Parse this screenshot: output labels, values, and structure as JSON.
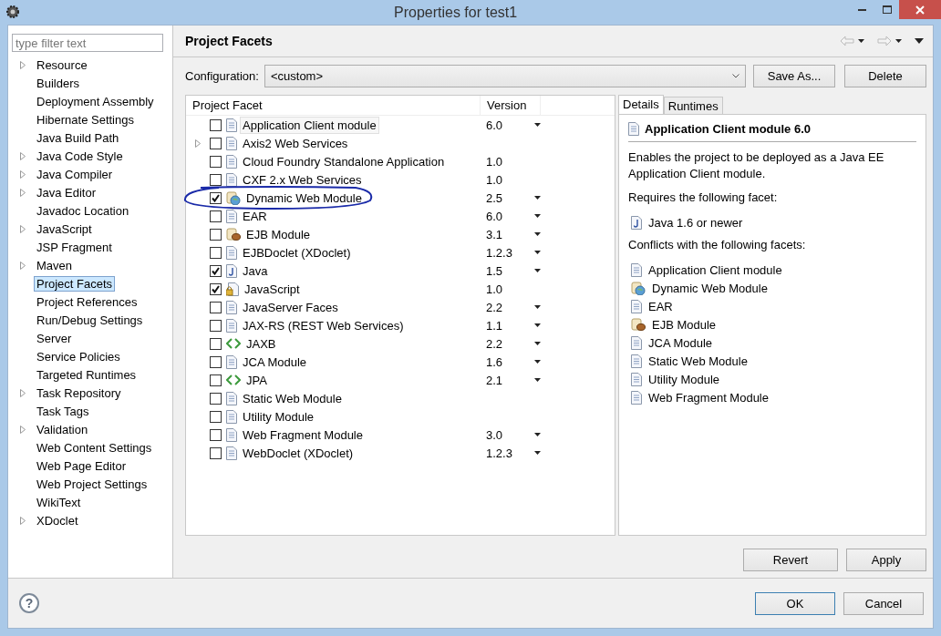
{
  "window": {
    "title": "Properties for test1"
  },
  "sidebar": {
    "filter_placeholder": "type filter text",
    "items": [
      {
        "label": "Resource",
        "expandable": true,
        "selected": false
      },
      {
        "label": "Builders",
        "expandable": false,
        "selected": false
      },
      {
        "label": "Deployment Assembly",
        "expandable": false,
        "selected": false
      },
      {
        "label": "Hibernate Settings",
        "expandable": false,
        "selected": false
      },
      {
        "label": "Java Build Path",
        "expandable": false,
        "selected": false
      },
      {
        "label": "Java Code Style",
        "expandable": true,
        "selected": false
      },
      {
        "label": "Java Compiler",
        "expandable": true,
        "selected": false
      },
      {
        "label": "Java Editor",
        "expandable": true,
        "selected": false
      },
      {
        "label": "Javadoc Location",
        "expandable": false,
        "selected": false
      },
      {
        "label": "JavaScript",
        "expandable": true,
        "selected": false
      },
      {
        "label": "JSP Fragment",
        "expandable": false,
        "selected": false
      },
      {
        "label": "Maven",
        "expandable": true,
        "selected": false
      },
      {
        "label": "Project Facets",
        "expandable": false,
        "selected": true
      },
      {
        "label": "Project References",
        "expandable": false,
        "selected": false
      },
      {
        "label": "Run/Debug Settings",
        "expandable": false,
        "selected": false
      },
      {
        "label": "Server",
        "expandable": false,
        "selected": false
      },
      {
        "label": "Service Policies",
        "expandable": false,
        "selected": false
      },
      {
        "label": "Targeted Runtimes",
        "expandable": false,
        "selected": false
      },
      {
        "label": "Task Repository",
        "expandable": true,
        "selected": false
      },
      {
        "label": "Task Tags",
        "expandable": false,
        "selected": false
      },
      {
        "label": "Validation",
        "expandable": true,
        "selected": false
      },
      {
        "label": "Web Content Settings",
        "expandable": false,
        "selected": false
      },
      {
        "label": "Web Page Editor",
        "expandable": false,
        "selected": false
      },
      {
        "label": "Web Project Settings",
        "expandable": false,
        "selected": false
      },
      {
        "label": "WikiText",
        "expandable": false,
        "selected": false
      },
      {
        "label": "XDoclet",
        "expandable": true,
        "selected": false
      }
    ]
  },
  "page": {
    "title": "Project Facets",
    "configuration": {
      "label": "Configuration:",
      "value": "<custom>"
    },
    "buttons": [
      "Save As...",
      "Delete"
    ]
  },
  "facets_table": {
    "columns": [
      "Project Facet",
      "Version"
    ],
    "rows": [
      {
        "name": "Application Client module",
        "kind": "document",
        "version": "6.0",
        "version_dropdown": true,
        "checked": false,
        "expandable": false,
        "selected": true,
        "circled": false
      },
      {
        "name": "Axis2 Web Services",
        "kind": "document",
        "checked": false,
        "expandable": true,
        "selected": false,
        "circled": false
      },
      {
        "name": "Cloud Foundry Standalone Application",
        "kind": "document",
        "version": "1.0",
        "version_dropdown": false,
        "checked": false,
        "expandable": false,
        "selected": false,
        "circled": false
      },
      {
        "name": "CXF 2.x Web Services",
        "kind": "document",
        "version": "1.0",
        "version_dropdown": false,
        "checked": false,
        "expandable": false,
        "selected": false,
        "circled": false
      },
      {
        "name": "Dynamic Web Module",
        "kind": "web",
        "version": "2.5",
        "version_dropdown": true,
        "checked": true,
        "expandable": false,
        "selected": false,
        "circled": true
      },
      {
        "name": "EAR",
        "kind": "document",
        "version": "6.0",
        "version_dropdown": true,
        "checked": false,
        "expandable": false,
        "selected": false,
        "circled": false
      },
      {
        "name": "EJB Module",
        "kind": "bean",
        "version": "3.1",
        "version_dropdown": true,
        "checked": false,
        "expandable": false,
        "selected": false,
        "circled": false
      },
      {
        "name": "EJBDoclet (XDoclet)",
        "kind": "document",
        "version": "1.2.3",
        "version_dropdown": true,
        "checked": false,
        "expandable": false,
        "selected": false,
        "circled": false
      },
      {
        "name": "Java",
        "kind": "java",
        "version": "1.5",
        "version_dropdown": true,
        "checked": true,
        "expandable": false,
        "selected": false,
        "circled": false
      },
      {
        "name": "JavaScript",
        "kind": "script",
        "version": "1.0",
        "version_dropdown": false,
        "checked": true,
        "expandable": false,
        "selected": false,
        "circled": false
      },
      {
        "name": "JavaServer Faces",
        "kind": "document",
        "version": "2.2",
        "version_dropdown": true,
        "checked": false,
        "expandable": false,
        "selected": false,
        "circled": false
      },
      {
        "name": "JAX-RS (REST Web Services)",
        "kind": "document",
        "version": "1.1",
        "version_dropdown": true,
        "checked": false,
        "expandable": false,
        "selected": false,
        "circled": false
      },
      {
        "name": "JAXB",
        "kind": "binding",
        "version": "2.2",
        "version_dropdown": true,
        "checked": false,
        "expandable": false,
        "selected": false,
        "circled": false
      },
      {
        "name": "JCA Module",
        "kind": "document",
        "version": "1.6",
        "version_dropdown": true,
        "checked": false,
        "expandable": false,
        "selected": false,
        "circled": false
      },
      {
        "name": "JPA",
        "kind": "binding",
        "version": "2.1",
        "version_dropdown": true,
        "checked": false,
        "expandable": false,
        "selected": false,
        "circled": false
      },
      {
        "name": "Static Web Module",
        "kind": "document",
        "checked": false,
        "expandable": false,
        "selected": false,
        "circled": false
      },
      {
        "name": "Utility Module",
        "kind": "document",
        "checked": false,
        "expandable": false,
        "selected": false,
        "circled": false
      },
      {
        "name": "Web Fragment Module",
        "kind": "document",
        "version": "3.0",
        "version_dropdown": true,
        "checked": false,
        "expandable": false,
        "selected": false,
        "circled": false
      },
      {
        "name": "WebDoclet (XDoclet)",
        "kind": "document",
        "version": "1.2.3",
        "version_dropdown": true,
        "checked": false,
        "expandable": false,
        "selected": false,
        "circled": false
      }
    ]
  },
  "details": {
    "tabs": [
      {
        "label": "Details",
        "selected": true
      },
      {
        "label": "Runtimes",
        "selected": false
      }
    ],
    "title": {
      "text": "Application Client module 6.0",
      "kind": "document"
    },
    "description": "Enables the project to be deployed as a Java EE Application Client module.",
    "requires_heading": "Requires the following facet:",
    "requires": [
      {
        "text": "Java 1.6 or newer",
        "kind": "java"
      }
    ],
    "conflicts_heading": "Conflicts with the following facets:",
    "conflicts": [
      {
        "text": "Application Client module",
        "kind": "document"
      },
      {
        "text": "Dynamic Web Module",
        "kind": "web"
      },
      {
        "text": "EAR",
        "kind": "document"
      },
      {
        "text": "EJB Module",
        "kind": "bean"
      },
      {
        "text": "JCA Module",
        "kind": "document"
      },
      {
        "text": "Static Web Module",
        "kind": "document"
      },
      {
        "text": "Utility Module",
        "kind": "document"
      },
      {
        "text": "Web Fragment Module",
        "kind": "document"
      }
    ]
  },
  "page_buttons": [
    "Revert",
    "Apply"
  ],
  "footer": {
    "help": "?",
    "buttons": [
      {
        "label": "OK",
        "default": true
      },
      {
        "label": "Cancel",
        "default": false
      }
    ]
  }
}
